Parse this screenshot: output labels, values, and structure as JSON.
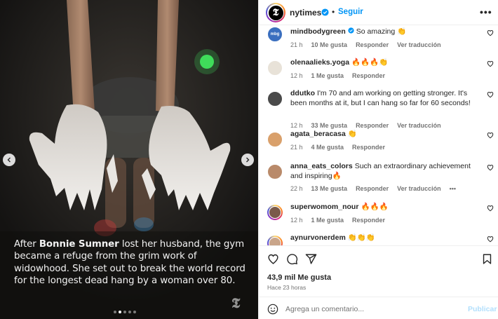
{
  "photo": {
    "caption_name": "Bonnie Sumner",
    "caption_pre": "After ",
    "caption_post": " lost her husband, the gym became a refuge from the grim work of widowhood. She set out to break the world record for the longest dead hang by a woman over 80.",
    "watermark": "T",
    "carousel_dots": 5,
    "active_dot": 1,
    "icons": {
      "prev": "chevron-left-icon",
      "next": "chevron-right-icon"
    }
  },
  "header": {
    "avatar_letter": "T",
    "username": "nytimes",
    "separator": "•",
    "follow_label": "Seguir",
    "more_label": "•••",
    "verified_color": "#0095f6"
  },
  "comments": [
    {
      "username": "mindbodygreen",
      "verified": true,
      "text": "So amazing 👏",
      "time": "21 h",
      "likes": "10 Me gusta",
      "reply": "Responder",
      "translate": "Ver traducción",
      "avatar_color": "#3b6fbf",
      "avatar_text": "mbg"
    },
    {
      "username": "olenaalieks.yoga",
      "verified": false,
      "text": "🔥🔥🔥👏",
      "time": "12 h",
      "likes": "1 Me gusta",
      "reply": "Responder",
      "translate": "",
      "avatar_color": "#e8e2d8",
      "avatar_text": ""
    },
    {
      "username": "ddutko",
      "verified": false,
      "text": "I'm 70 and am working on getting stronger. It's been months at it, but I can hang so far for 60 seconds!",
      "time": "12 h",
      "likes": "33 Me gusta",
      "reply": "Responder",
      "translate": "Ver traducción",
      "avatar_color": "#4a4a4a",
      "avatar_text": ""
    },
    {
      "username": "agata_beracasa",
      "verified": false,
      "text": "👏",
      "time": "21 h",
      "likes": "4 Me gusta",
      "reply": "Responder",
      "translate": "",
      "avatar_color": "#d9a06b",
      "avatar_text": ""
    },
    {
      "username": "anna_eats_colors",
      "verified": false,
      "text": "Such an extraordinary achievement and inspiring🔥",
      "time": "22 h",
      "likes": "13 Me gusta",
      "reply": "Responder",
      "translate": "Ver traducción",
      "more": "•••",
      "avatar_color": "#b98a6a",
      "avatar_text": ""
    },
    {
      "username": "superwomom_nour",
      "verified": false,
      "text": "🔥🔥🔥",
      "time": "12 h",
      "likes": "1 Me gusta",
      "reply": "Responder",
      "translate": "",
      "avatar_color": "#7a5a4a",
      "avatar_text": "",
      "ring": true
    },
    {
      "username": "aynurvonerdem",
      "verified": false,
      "text": "👏👏👏",
      "time": "",
      "likes": "",
      "reply": "",
      "translate": "",
      "avatar_color": "#c9a58a",
      "avatar_text": "",
      "ring": true
    }
  ],
  "actions": {
    "likes": "43,9 mil Me gusta",
    "time_ago": "Hace 23 horas",
    "icons": [
      "heart-icon",
      "comment-icon",
      "share-icon",
      "save-icon"
    ]
  },
  "compose": {
    "placeholder": "Agrega un comentario...",
    "value": "",
    "publish_label": "Publicar",
    "publish_color": "#b2dffc"
  }
}
